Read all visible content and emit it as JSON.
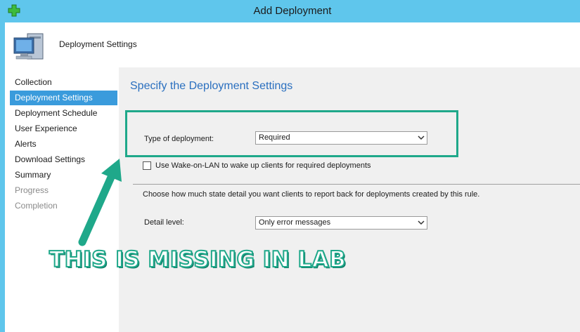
{
  "window": {
    "title": "Add Deployment"
  },
  "header": {
    "title": "Deployment Settings",
    "icon": "computer-icon"
  },
  "nav": {
    "items": [
      {
        "label": "Collection",
        "state": "normal"
      },
      {
        "label": "Deployment Settings",
        "state": "active"
      },
      {
        "label": "Deployment Schedule",
        "state": "normal"
      },
      {
        "label": "User Experience",
        "state": "normal"
      },
      {
        "label": "Alerts",
        "state": "normal"
      },
      {
        "label": "Download Settings",
        "state": "normal"
      },
      {
        "label": "Summary",
        "state": "normal"
      },
      {
        "label": "Progress",
        "state": "disabled"
      },
      {
        "label": "Completion",
        "state": "disabled"
      }
    ]
  },
  "main": {
    "heading": "Specify the Deployment Settings",
    "deployment_type": {
      "label": "Type of deployment:",
      "value": "Required"
    },
    "wol": {
      "label": "Use Wake-on-LAN to wake up clients for required deployments",
      "checked": false
    },
    "state_detail_text": "Choose how much state detail you want clients to report back for deployments created by this rule.",
    "detail_level": {
      "label": "Detail level:",
      "value": "Only error messages"
    }
  },
  "annotation": {
    "text": "THIS IS MISSING IN LAB"
  },
  "colors": {
    "titlebar": "#5fc6ec",
    "accent": "#1fa88a",
    "nav_active": "#3a9bdc",
    "heading": "#2a6fbf"
  }
}
